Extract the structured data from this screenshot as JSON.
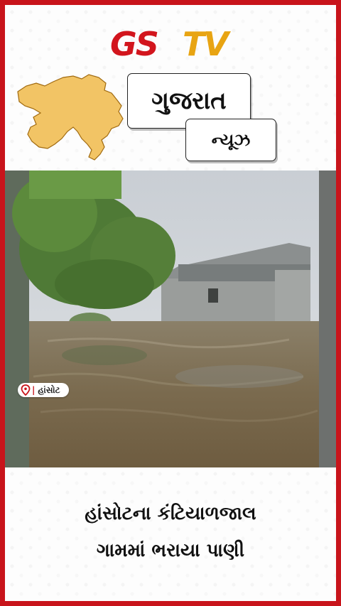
{
  "brand": {
    "logo_part1": "GS",
    "logo_part2": "TV",
    "accent_red": "#c8141b",
    "accent_yellow": "#e8a412"
  },
  "header": {
    "title": "ગુજરાત",
    "subtitle": "ન્યૂઝ",
    "map_icon": "gujarat-map-icon"
  },
  "photo": {
    "location_label": "હાંસોટ",
    "location_icon": "location-pin-icon"
  },
  "headline": {
    "line1": "હાંસોટના કંટિયાળજાલ",
    "line2": "ગામમાં ભરાયા પાણી"
  }
}
